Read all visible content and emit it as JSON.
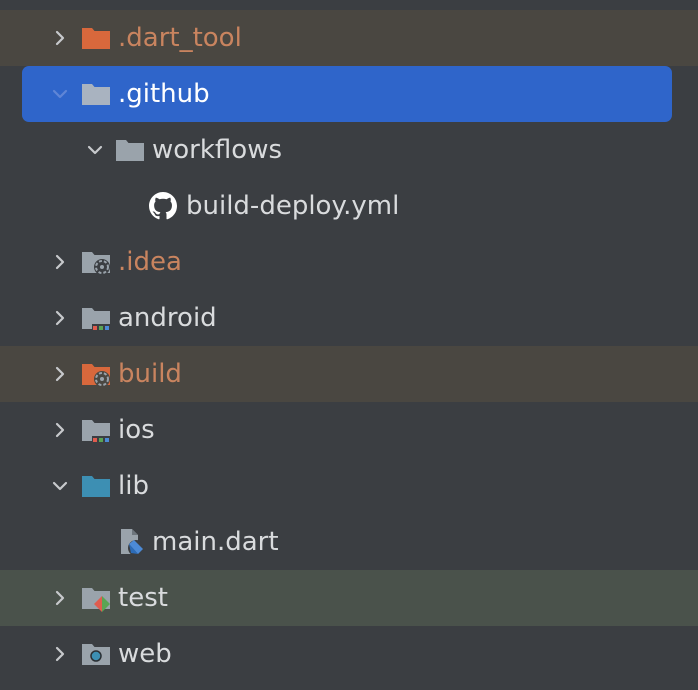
{
  "colors": {
    "background": "#3b3e42",
    "excluded_row": "#4a4741",
    "test_row": "#4a524b",
    "selection": "#2f65ca",
    "excluded_text": "#c9845f",
    "normal_text": "#d9dbdd",
    "folder_gray": "#9aa3ab",
    "folder_orange": "#d8683c",
    "folder_teal": "#3d8fb3"
  },
  "tree": {
    "items": [
      {
        "label": ".dart_tool",
        "icon": "excluded-folder-icon",
        "arrow": "chevron-right"
      },
      {
        "label": ".github",
        "icon": "folder-icon",
        "arrow": "chevron-down"
      },
      {
        "label": "workflows",
        "icon": "folder-icon",
        "arrow": "chevron-down"
      },
      {
        "label": "build-deploy.yml",
        "icon": "github-icon"
      },
      {
        "label": ".idea",
        "icon": "idea-settings-folder-icon",
        "arrow": "chevron-right"
      },
      {
        "label": "android",
        "icon": "android-module-folder-icon",
        "arrow": "chevron-right"
      },
      {
        "label": "build",
        "icon": "excluded-build-folder-icon",
        "arrow": "chevron-right"
      },
      {
        "label": "ios",
        "icon": "ios-module-folder-icon",
        "arrow": "chevron-right"
      },
      {
        "label": "lib",
        "icon": "source-folder-icon",
        "arrow": "chevron-down"
      },
      {
        "label": "main.dart",
        "icon": "dart-file-icon"
      },
      {
        "label": "test",
        "icon": "test-folder-icon",
        "arrow": "chevron-right"
      },
      {
        "label": "web",
        "icon": "web-folder-icon",
        "arrow": "chevron-right"
      }
    ]
  }
}
